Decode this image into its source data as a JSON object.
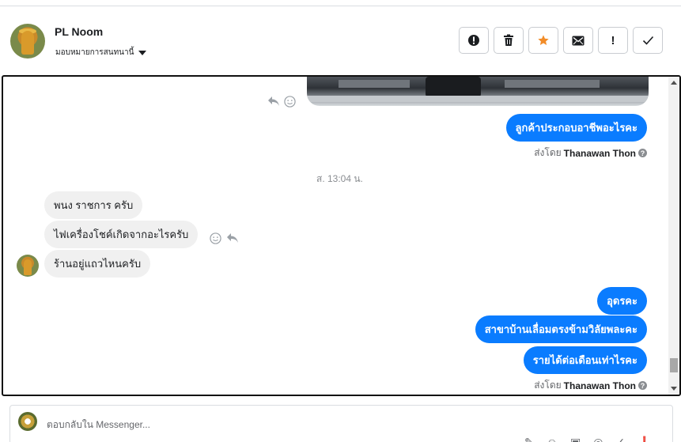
{
  "header": {
    "contact_name": "PL Noom",
    "assign_label": "มอบหมายการสนทนานี้"
  },
  "toolbar": {
    "buttons": [
      {
        "name": "mark-spam",
        "icon": "exclamation-circle-icon"
      },
      {
        "name": "delete",
        "icon": "trash-icon"
      },
      {
        "name": "star",
        "icon": "star-icon"
      },
      {
        "name": "mark-unread",
        "icon": "envelope-icon"
      },
      {
        "name": "mark-important",
        "icon": "exclamation-icon"
      },
      {
        "name": "mark-done",
        "icon": "checkmark-icon"
      }
    ],
    "star_color": "#f28c28"
  },
  "conversation": {
    "messages_top": [
      {
        "text": "ลูกค้าประกอบอาชีพอะไรคะ"
      }
    ],
    "sent_by_1": {
      "prefix": "ส่งโดย",
      "agent": "Thanawan Thon"
    },
    "timestamp": "ส. 13:04 น.",
    "incoming": [
      {
        "text": "พนง ราชการ ครับ"
      },
      {
        "text": "ไฟเครื่องโชค์เกิดจากอะไรครับ"
      },
      {
        "text": "ร้านอยู่แถวไหนครับ"
      }
    ],
    "outgoing": [
      {
        "text": "อุดรคะ"
      },
      {
        "text": "สาขาบ้านเลื่อมตรงข้ามวิลัยพละคะ"
      },
      {
        "text": "รายได้ต่อเดือนเท่าไรคะ"
      }
    ],
    "sent_by_2": {
      "prefix": "ส่งโดย",
      "agent": "Thanawan Thon"
    },
    "outgoing_color": "#0a7cff",
    "incoming_color": "#f0f0f0"
  },
  "reply": {
    "placeholder": "ตอบกลับใน Messenger..."
  }
}
